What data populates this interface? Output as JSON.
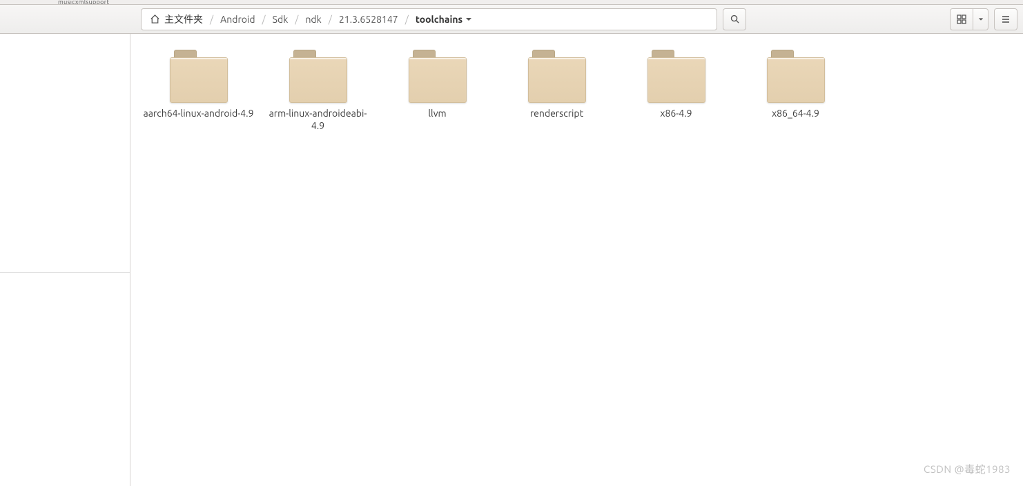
{
  "top_strip": {
    "tab_fragment": "musicxmlsupport"
  },
  "breadcrumb": {
    "home": "主文件夹",
    "parts": [
      "Android",
      "Sdk",
      "ndk",
      "21.3.6528147"
    ],
    "current": "toolchains"
  },
  "folders": [
    {
      "name": "aarch64-linux-android-4.9"
    },
    {
      "name": "arm-linux-androideabi-4.9"
    },
    {
      "name": "llvm"
    },
    {
      "name": "renderscript"
    },
    {
      "name": "x86-4.9"
    },
    {
      "name": "x86_64-4.9"
    }
  ],
  "watermark": "CSDN @毒蛇1983"
}
